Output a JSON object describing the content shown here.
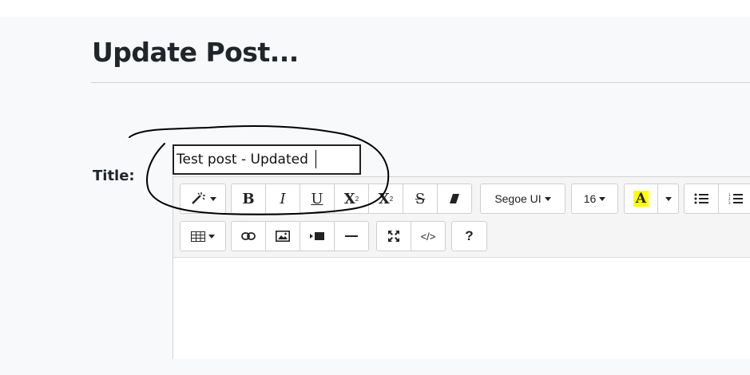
{
  "page": {
    "heading": "Update Post...",
    "title_label": "Title:",
    "title_value": "Test post - Updated"
  },
  "toolbar": {
    "style_icon": "magic-wand-icon",
    "bold": "B",
    "italic": "I",
    "underline": "U",
    "superscript": "X",
    "subscript": "X",
    "strikethrough": "S",
    "font_name": "Segoe UI",
    "font_size": "16",
    "color_letter": "A",
    "highlight_color": "#ffff00",
    "code_view": "</>",
    "help": "?"
  }
}
